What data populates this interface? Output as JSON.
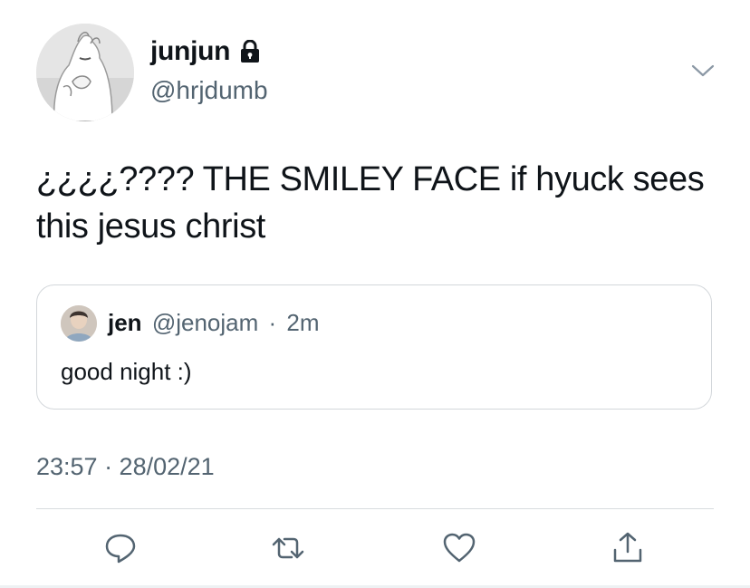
{
  "author": {
    "display_name": "junjun",
    "handle": "@hrjdumb",
    "avatar_icon": "moomin-avatar",
    "protected_icon": "lock-icon"
  },
  "tweet": {
    "text": "¿¿¿¿???? THE SMILEY FACE if hyuck sees this jesus christ"
  },
  "quote": {
    "name": "jen",
    "handle": "@jenojam",
    "separator": "·",
    "time": "2m",
    "text": "good night :)"
  },
  "meta": {
    "timestamp": "23:57 · 28/02/21"
  },
  "actions": {
    "reply_icon": "reply-icon",
    "retweet_icon": "retweet-icon",
    "like_icon": "heart-icon",
    "share_icon": "share-icon"
  },
  "colors": {
    "text": "#0f1419",
    "secondary": "#536471",
    "border": "#d3d7db"
  }
}
